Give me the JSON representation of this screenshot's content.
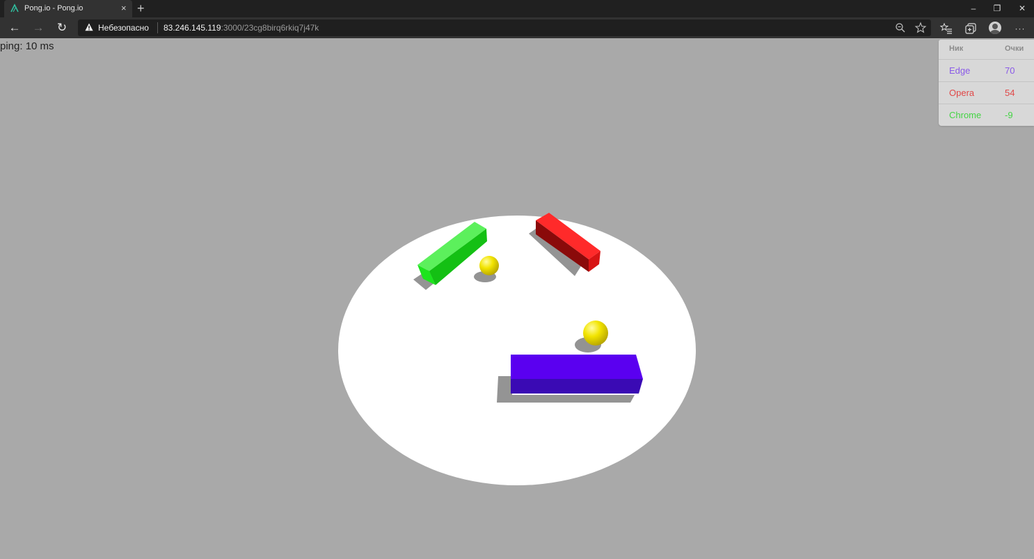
{
  "browser": {
    "tab_title": "Pong.io - Pong.io",
    "tab_close": "×",
    "new_tab": "+",
    "window_controls": {
      "minimize": "–",
      "restore": "❐",
      "close": "✕"
    },
    "nav": {
      "back": "←",
      "forward": "→",
      "reload": "↻"
    },
    "security_warning": "Небезопасно",
    "url_host": "83.246.145.119",
    "url_rest": ":3000/23cg8birq6rkiq7j47k",
    "icons": {
      "zoom": "zoom-icon",
      "favorite": "star-icon",
      "favorites": "favorites-list-icon",
      "collections": "collections-icon",
      "profile": "profile-avatar-icon",
      "menu": "more-icon"
    },
    "menu_glyph": "···"
  },
  "game": {
    "ping_text": "ping: 10 ms",
    "colors": {
      "background": "#a9a9a9",
      "arena": "#ffffff",
      "ball": "#f0e000",
      "green_paddle": "#1ee81e",
      "red_paddle": "#f01c1c",
      "purple_paddle": "#5a00f0"
    }
  },
  "scoreboard": {
    "header": {
      "nick": "Ник",
      "score": "Очки"
    },
    "rows": [
      {
        "nick": "Edge",
        "score": "70",
        "color": "#8a5ae8"
      },
      {
        "nick": "Opera",
        "score": "54",
        "color": "#e04848"
      },
      {
        "nick": "Chrome",
        "score": "-9",
        "color": "#44d444"
      }
    ]
  }
}
